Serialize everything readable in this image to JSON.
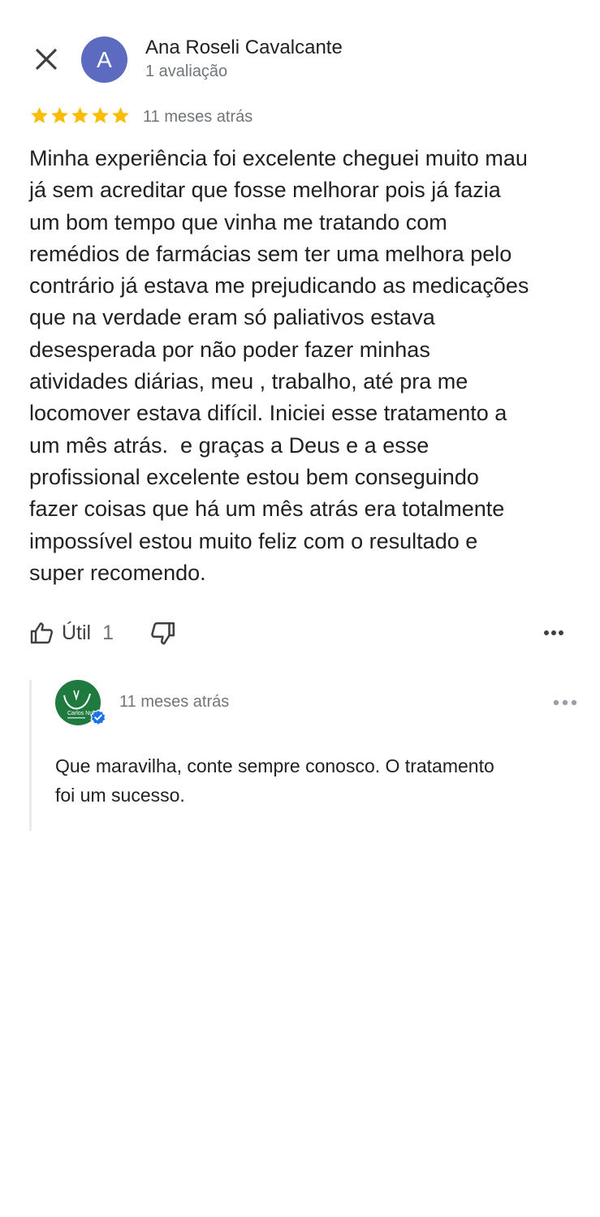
{
  "header": {
    "close_icon": "close-icon",
    "author": {
      "avatar_letter": "A",
      "avatar_color": "#5c6bc0",
      "name": "Ana Roseli Cavalcante",
      "review_count": "1 avaliação"
    }
  },
  "review": {
    "rating": 5,
    "max_rating": 5,
    "star_color": "#fbbc04",
    "time": "11 meses atrás",
    "text": "Minha experiência foi excelente cheguei muito mau\njá sem acreditar que fosse melhorar pois já fazia\num bom tempo que vinha me tratando com\nremédios de farmácias sem ter uma melhora pelo\ncontrário já estava me prejudicando as medicações\nque na verdade eram só paliativos estava\ndesesperada por não poder fazer minhas\natividades diárias, meu , trabalho, até pra me\nlocomover estava difícil. Iniciei esse tratamento a\num mês atrás.  e graças a Deus e a esse\nprofissional excelente estou bem conseguindo\nfazer coisas que há um mês atrás era totalmente\nimpossível estou muito feliz com o resultado e\nsuper recomendo."
  },
  "actions": {
    "helpful_icon": "thumbs-up-icon",
    "helpful_label": "Útil",
    "helpful_count": "1",
    "not_helpful_icon": "thumbs-down-icon",
    "more_icon": "more-horizontal-icon"
  },
  "owner_reply": {
    "logo_text": "Carlos Nob",
    "verified_icon": "verified-badge-icon",
    "brand_color": "#1e7a3e",
    "time": "11 meses atrás",
    "text": "Que maravilha, conte sempre conosco. O tratamento\nfoi um sucesso.",
    "more_icon": "more-horizontal-icon"
  }
}
